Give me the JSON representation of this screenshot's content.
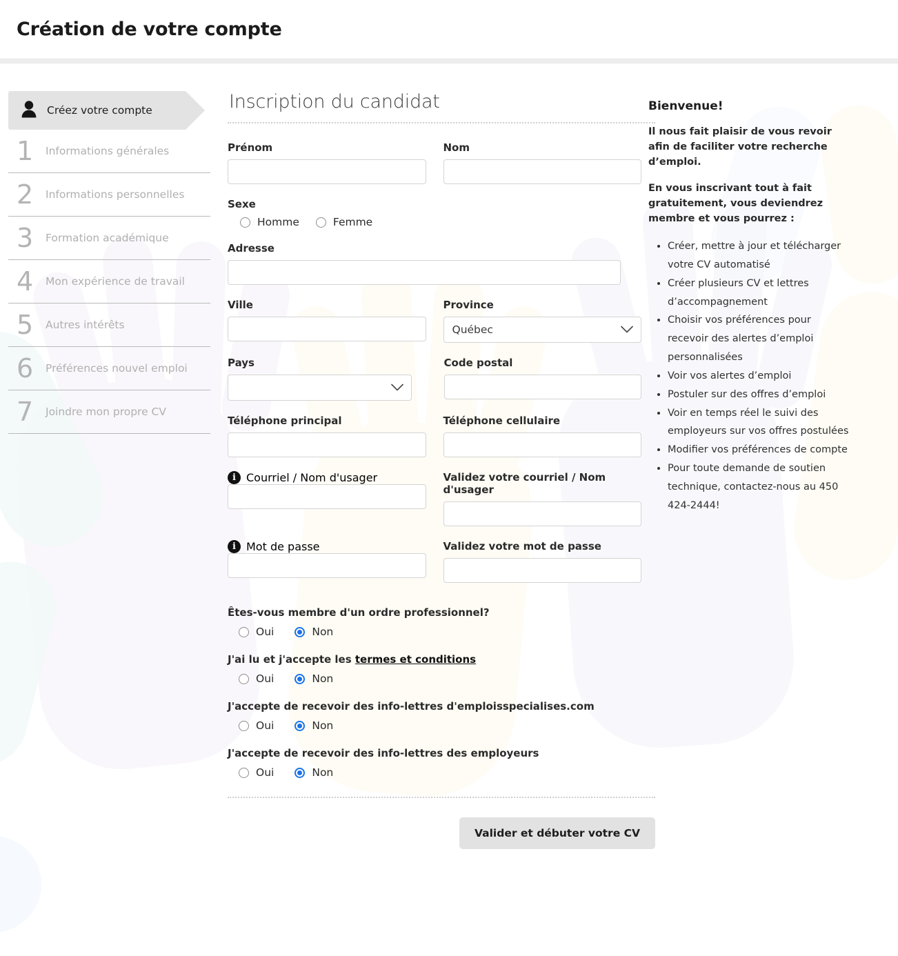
{
  "header": {
    "title": "Création de votre compte"
  },
  "steps": {
    "active": {
      "label": "Créez votre compte",
      "icon": "person-icon"
    },
    "items": [
      {
        "num": "1",
        "label": "Informations générales"
      },
      {
        "num": "2",
        "label": "Informations personnelles"
      },
      {
        "num": "3",
        "label": "Formation académique"
      },
      {
        "num": "4",
        "label": "Mon expérience de travail"
      },
      {
        "num": "5",
        "label": "Autres intérêts"
      },
      {
        "num": "6",
        "label": "Préférences nouvel emploi"
      },
      {
        "num": "7",
        "label": "Joindre mon propre CV"
      }
    ]
  },
  "form": {
    "title": "Inscription du candidat",
    "prenom": {
      "label": "Prénom",
      "value": ""
    },
    "nom": {
      "label": "Nom",
      "value": ""
    },
    "sexe": {
      "label": "Sexe",
      "options": [
        {
          "label": "Homme",
          "selected": false
        },
        {
          "label": "Femme",
          "selected": false
        }
      ]
    },
    "adresse": {
      "label": "Adresse",
      "value": ""
    },
    "ville": {
      "label": "Ville",
      "value": ""
    },
    "province": {
      "label": "Province",
      "value": "Québec"
    },
    "pays": {
      "label": "Pays",
      "value": ""
    },
    "code_postal": {
      "label": "Code postal",
      "value": ""
    },
    "tel_principal": {
      "label": "Téléphone principal",
      "value": ""
    },
    "tel_cellulaire": {
      "label": "Téléphone cellulaire",
      "value": ""
    },
    "courriel": {
      "label": "Courriel / Nom d'usager",
      "value": "",
      "icon": "info-icon"
    },
    "courriel_valide": {
      "label": "Validez votre courriel / Nom d'usager",
      "value": ""
    },
    "mot_de_passe": {
      "label": "Mot de passe",
      "value": "",
      "icon": "info-icon"
    },
    "mot_de_passe_valide": {
      "label": "Validez votre mot de passe",
      "value": ""
    },
    "questions": [
      {
        "label": "Êtes-vous membre d'un ordre professionnel?",
        "link": "",
        "options": [
          {
            "label": "Oui",
            "selected": false
          },
          {
            "label": "Non",
            "selected": true
          }
        ]
      },
      {
        "label": "J'ai lu et j'accepte les ",
        "link": "termes et conditions",
        "options": [
          {
            "label": "Oui",
            "selected": false
          },
          {
            "label": "Non",
            "selected": true
          }
        ]
      },
      {
        "label": "J'accepte de recevoir des info-lettres d'emploisspecialises.com",
        "link": "",
        "options": [
          {
            "label": "Oui",
            "selected": false
          },
          {
            "label": "Non",
            "selected": true
          }
        ]
      },
      {
        "label": "J'accepte de recevoir des info-lettres des employeurs",
        "link": "",
        "options": [
          {
            "label": "Oui",
            "selected": false
          },
          {
            "label": "Non",
            "selected": true
          }
        ]
      }
    ],
    "submit_label": "Valider et débuter votre CV"
  },
  "welcome": {
    "heading": "Bienvenue!",
    "paragraphs": [
      "Il nous fait plaisir de vous revoir afin de faciliter votre recherche d’emploi.",
      "En vous inscrivant tout à fait gratuitement, vous deviendrez membre et vous pourrez :"
    ],
    "bullets": [
      "Créer, mettre à jour et télécharger votre CV automatisé",
      "Créer plusieurs CV et lettres d’accompagnement",
      "Choisir vos préférences pour recevoir des alertes d’emploi personnalisées",
      "Voir vos alertes d’emploi",
      "Postuler sur des offres d’emploi",
      "Voir en temps réel le suivi des employeurs sur vos offres postulées",
      "Modifier vos préférences de compte",
      "Pour toute demande de soutien technique, contactez-nous au 450 424-2444!"
    ]
  },
  "colors": {
    "accent_radio": "#1a73e8",
    "step_active_bg": "#e3e3e3",
    "button_bg": "#e2e2e2",
    "divider": "#eeeeee"
  }
}
